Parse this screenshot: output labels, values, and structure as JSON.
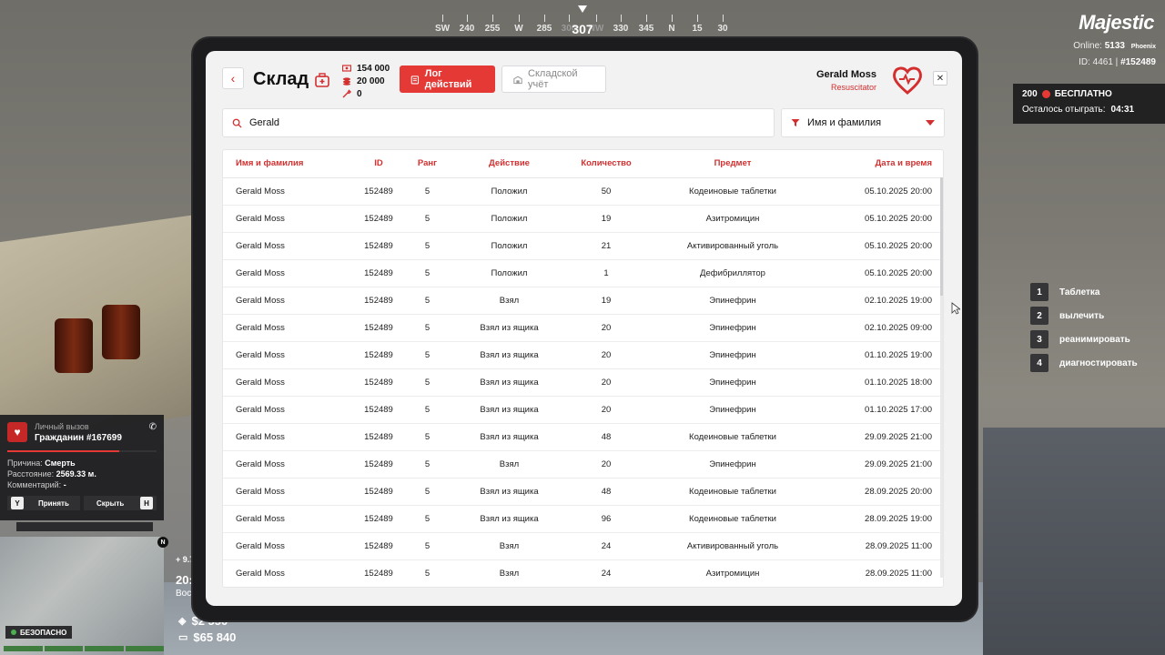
{
  "compass": {
    "marks": [
      "SW",
      "240",
      "255",
      "W",
      "285",
      "300",
      "NW",
      "330",
      "345",
      "N",
      "15",
      "30"
    ],
    "heading": "307"
  },
  "hud": {
    "brand": "Majestic",
    "online_label": "Online:",
    "online_value": "5133",
    "server": "Phoenix",
    "id_label": "ID: 4461 |",
    "id_value": "#152489",
    "promo_count": "200",
    "promo_label": "БЕСПЛАТНО",
    "promo_remaining_label": "Осталось отыграть:",
    "promo_remaining_value": "04:31",
    "safe_label": "БЕЗОПАСНО",
    "cash": "$2 550",
    "bank": "$65 840",
    "compass_letter": "N",
    "partial_speed": "+ 9.7",
    "partial_time": "20:",
    "partial_loc": "Вос"
  },
  "actions": [
    {
      "key": "1",
      "label": "Таблетка"
    },
    {
      "key": "2",
      "label": "вылечить"
    },
    {
      "key": "3",
      "label": "реанимировать"
    },
    {
      "key": "4",
      "label": "диагностировать"
    }
  ],
  "call": {
    "title_small": "Личный вызов",
    "title": "Гражданин #167699",
    "reason_label": "Причина:",
    "reason_value": "Смерть",
    "distance_label": "Расстояние:",
    "distance_value": "2569.33 м.",
    "comment_label": "Комментарий:",
    "comment_value": "-",
    "accept_key": "Y",
    "accept_label": "Принять",
    "hide_label": "Скрыть",
    "hide_key": "H"
  },
  "tablet": {
    "title": "Склад",
    "stats": [
      "154 000",
      "20 000",
      "0"
    ],
    "tab_active": "Лог действий",
    "tab_inactive": "Складской учёт",
    "user_name": "Gerald Moss",
    "user_role": "Resuscitator",
    "search_value": "Gerald",
    "filter_label": "Имя и фамилия",
    "columns": [
      "Имя и фамилия",
      "ID",
      "Ранг",
      "Действие",
      "Количество",
      "Предмет",
      "Дата и время"
    ],
    "rows": [
      [
        "Gerald Moss",
        "152489",
        "5",
        "Положил",
        "50",
        "Кодеиновые таблетки",
        "05.10.2025 20:00"
      ],
      [
        "Gerald Moss",
        "152489",
        "5",
        "Положил",
        "19",
        "Азитромицин",
        "05.10.2025 20:00"
      ],
      [
        "Gerald Moss",
        "152489",
        "5",
        "Положил",
        "21",
        "Активированный уголь",
        "05.10.2025 20:00"
      ],
      [
        "Gerald Moss",
        "152489",
        "5",
        "Положил",
        "1",
        "Дефибриллятор",
        "05.10.2025 20:00"
      ],
      [
        "Gerald Moss",
        "152489",
        "5",
        "Взял",
        "19",
        "Эпинефрин",
        "02.10.2025 19:00"
      ],
      [
        "Gerald Moss",
        "152489",
        "5",
        "Взял из ящика",
        "20",
        "Эпинефрин",
        "02.10.2025 09:00"
      ],
      [
        "Gerald Moss",
        "152489",
        "5",
        "Взял из ящика",
        "20",
        "Эпинефрин",
        "01.10.2025 19:00"
      ],
      [
        "Gerald Moss",
        "152489",
        "5",
        "Взял из ящика",
        "20",
        "Эпинефрин",
        "01.10.2025 18:00"
      ],
      [
        "Gerald Moss",
        "152489",
        "5",
        "Взял из ящика",
        "20",
        "Эпинефрин",
        "01.10.2025 17:00"
      ],
      [
        "Gerald Moss",
        "152489",
        "5",
        "Взял из ящика",
        "48",
        "Кодеиновые таблетки",
        "29.09.2025 21:00"
      ],
      [
        "Gerald Moss",
        "152489",
        "5",
        "Взял",
        "20",
        "Эпинефрин",
        "29.09.2025 21:00"
      ],
      [
        "Gerald Moss",
        "152489",
        "5",
        "Взял из ящика",
        "48",
        "Кодеиновые таблетки",
        "28.09.2025 20:00"
      ],
      [
        "Gerald Moss",
        "152489",
        "5",
        "Взял из ящика",
        "96",
        "Кодеиновые таблетки",
        "28.09.2025 19:00"
      ],
      [
        "Gerald Moss",
        "152489",
        "5",
        "Взял",
        "24",
        "Активированный уголь",
        "28.09.2025 11:00"
      ],
      [
        "Gerald Moss",
        "152489",
        "5",
        "Взял",
        "24",
        "Азитромицин",
        "28.09.2025 11:00"
      ]
    ]
  },
  "colors": {
    "accent": "#e53935",
    "accent_dark": "#d32f2f",
    "panel": "#f2f2f3"
  },
  "icons": [
    "back-arrow-icon",
    "medkit-icon",
    "cash-icon",
    "coins-icon",
    "wrench-icon",
    "clipboard-icon",
    "warehouse-icon",
    "heart-logo-icon",
    "close-icon",
    "search-icon",
    "filter-icon",
    "phone-icon",
    "cursor-icon"
  ]
}
